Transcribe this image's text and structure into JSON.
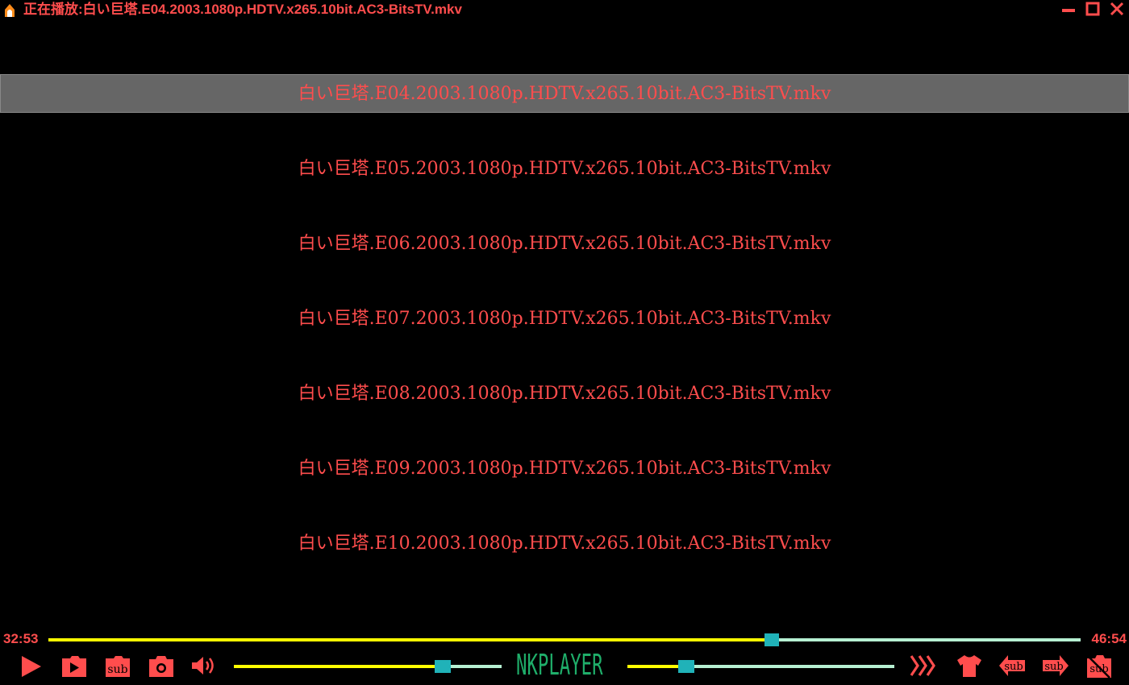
{
  "window": {
    "title": "正在播放:白い巨塔.E04.2003.1080p.HDTV.x265.10bit.AC3-BitsTV.mkv",
    "icon": "fox-app-icon",
    "buttons": [
      "minimize-icon",
      "maximize-icon",
      "close-icon"
    ]
  },
  "playlist": {
    "items": [
      {
        "label": "白い巨塔.E04.2003.1080p.HDTV.x265.10bit.AC3-BitsTV.mkv",
        "selected": true
      },
      {
        "label": "白い巨塔.E05.2003.1080p.HDTV.x265.10bit.AC3-BitsTV.mkv",
        "selected": false
      },
      {
        "label": "白い巨塔.E06.2003.1080p.HDTV.x265.10bit.AC3-BitsTV.mkv",
        "selected": false
      },
      {
        "label": "白い巨塔.E07.2003.1080p.HDTV.x265.10bit.AC3-BitsTV.mkv",
        "selected": false
      },
      {
        "label": "白い巨塔.E08.2003.1080p.HDTV.x265.10bit.AC3-BitsTV.mkv",
        "selected": false
      },
      {
        "label": "白い巨塔.E09.2003.1080p.HDTV.x265.10bit.AC3-BitsTV.mkv",
        "selected": false
      },
      {
        "label": "白い巨塔.E10.2003.1080p.HDTV.x265.10bit.AC3-BitsTV.mkv",
        "selected": false
      }
    ]
  },
  "playback": {
    "current_time": "32:53",
    "total_time": "46:54",
    "progress_fraction": 0.701
  },
  "controls": {
    "left_icons": [
      "play-icon",
      "next-video-icon",
      "subtitle-icon",
      "camera-icon",
      "volume-icon"
    ],
    "right_icons": [
      "fast-forward-icon",
      "shirt-skin-icon",
      "subtitle-back-icon",
      "subtitle-forward-icon",
      "subtitle-off-icon"
    ],
    "sub_label": "sub",
    "volume_fraction": 0.78,
    "slider2_fraction": 0.22
  },
  "logo": {
    "text": "NKPLAYER"
  },
  "colors": {
    "accent": "#ff4d4d",
    "progress_played": "#ffff00",
    "progress_remaining": "#b6f0d2",
    "knob": "#20b2b8",
    "logo": "#1fae6a",
    "selected_row": "#666666"
  }
}
